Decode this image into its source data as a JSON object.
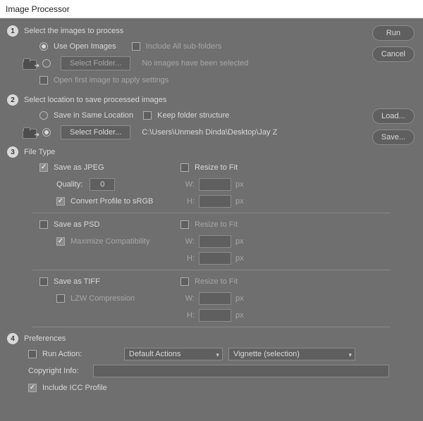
{
  "window": {
    "title": "Image Processor"
  },
  "buttons": {
    "run": "Run",
    "cancel": "Cancel",
    "load": "Load...",
    "save": "Save...",
    "select_folder": "Select Folder..."
  },
  "step1": {
    "title": "Select the images to process",
    "use_open": "Use Open Images",
    "include_sub": "Include All sub-folders",
    "no_images": "No images have been selected",
    "open_first": "Open first image to apply settings"
  },
  "step2": {
    "title": "Select location to save processed images",
    "same_loc": "Save in Same Location",
    "keep_folder": "Keep folder structure",
    "path": "C:\\Users\\Unmesh Dinda\\Desktop\\Jay Z"
  },
  "step3": {
    "title": "File Type",
    "jpeg": "Save as JPEG",
    "quality_lbl": "Quality:",
    "quality_val": "0",
    "convert_srgb": "Convert Profile to sRGB",
    "resize_fit": "Resize to Fit",
    "w": "W:",
    "h": "H:",
    "px": "px",
    "psd": "Save as PSD",
    "max_compat": "Maximize Compatibility",
    "tiff": "Save as TIFF",
    "lzw": "LZW Compression"
  },
  "step4": {
    "title": "Preferences",
    "run_action": "Run Action:",
    "action_set": "Default Actions",
    "action_name": "Vignette (selection)",
    "copyright": "Copyright Info:",
    "icc": "Include ICC Profile"
  }
}
